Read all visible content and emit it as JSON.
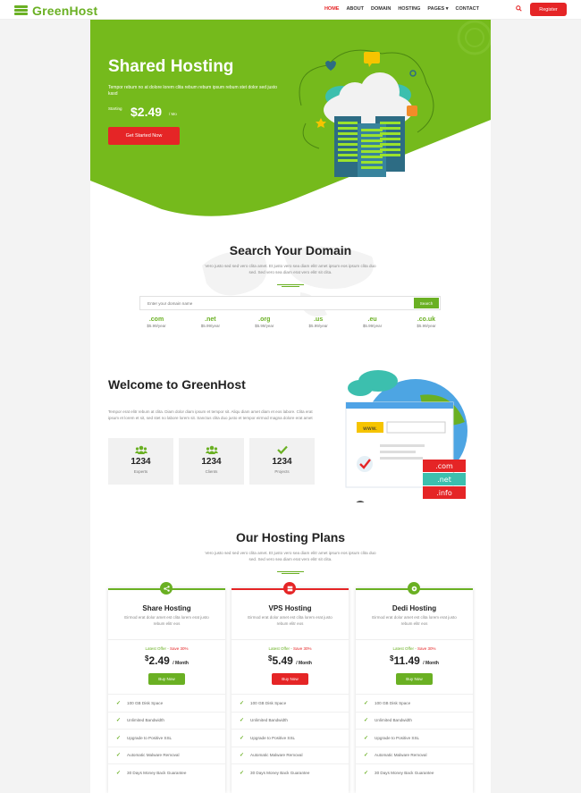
{
  "brand": {
    "name": "GreenHost"
  },
  "nav": {
    "items": [
      "HOME",
      "ABOUT",
      "DOMAIN",
      "HOSTING",
      "PAGES ▾",
      "CONTACT"
    ],
    "register": "Register"
  },
  "hero": {
    "title": "Shared Hosting",
    "description": "Tempor rebum no at dolore lorem clita rebum rebum ipsum rebum stet dolor sed justo kasd",
    "starting_label": "Starting",
    "price": "$2.49",
    "per": "/ Mo",
    "cta": "Get Started Now"
  },
  "domain": {
    "title": "Search Your Domain",
    "subtitle": "Vero justo sed sed vero clita amet. Et justo vero sea diam elitr amet ipsum eos ipsum clita duo sed. Sed vero sea diam erat vero elitr sit clita.",
    "placeholder": "Enter your domain name",
    "search_label": "Search",
    "tlds": [
      {
        "ext": ".com",
        "price": "$5.99/year"
      },
      {
        "ext": ".net",
        "price": "$5.99/year"
      },
      {
        "ext": ".org",
        "price": "$5.99/year"
      },
      {
        "ext": ".us",
        "price": "$5.99/year"
      },
      {
        "ext": ".eu",
        "price": "$5.99/year"
      },
      {
        "ext": ".co.uk",
        "price": "$5.99/year"
      }
    ]
  },
  "welcome": {
    "title": "Welcome to GreenHost",
    "text": "Tempor erat elitr rebum at clita. Diam dolor diam ipsum et tempor sit. Aliqu diam amet diam et eos labore. Clita erat ipsum et lorem et sit, sed stet no labore lorem sit. Sanctus clita duo justo et tempor eirmod magna dolore erat amet",
    "stats": [
      {
        "icon": "users-icon",
        "number": "1234",
        "label": "Experts"
      },
      {
        "icon": "clients-icon",
        "number": "1234",
        "label": "Clients"
      },
      {
        "icon": "check-icon",
        "number": "1234",
        "label": "Projects"
      }
    ],
    "illustration_tags": [
      ".com",
      ".net",
      ".info"
    ],
    "illustration_url": "www."
  },
  "plans": {
    "title": "Our Hosting Plans",
    "subtitle": "Vero justo sed sed vero clita amet. Et justo vero sea diam elitr amet ipsum eos ipsum clita duo sed. Sed vero sea diam erat vero elitr sit clita.",
    "offer_label": "Latest Offer - ",
    "offer_save": "Save 30%",
    "currency": "$",
    "per": "/ Month",
    "items": [
      {
        "name": "Share Hosting",
        "desc": "Eirmod erat dolor amet est clita lorem erat justo rebum elitr eos",
        "price": "2.49",
        "button": "Buy Now",
        "accent": "#6ab023"
      },
      {
        "name": "VPS Hosting",
        "desc": "Eirmod erat dolor amet est clita lorem erat justo rebum elitr eos",
        "price": "5.49",
        "button": "Buy Now",
        "accent": "#e52526"
      },
      {
        "name": "Dedi Hosting",
        "desc": "Eirmod erat dolor amet est clita lorem erat justo rebum elitr eos",
        "price": "11.49",
        "button": "Buy Now",
        "accent": "#6ab023"
      }
    ],
    "features": [
      "100 GB Disk Space",
      "Unlimited Bandwidth",
      "Upgrade to Positive SSL",
      "Automatic Malware Removal",
      "30 Days Money Back Guarantee"
    ]
  },
  "colors": {
    "green": "#6ab023",
    "red": "#e52526",
    "dark": "#222222"
  }
}
